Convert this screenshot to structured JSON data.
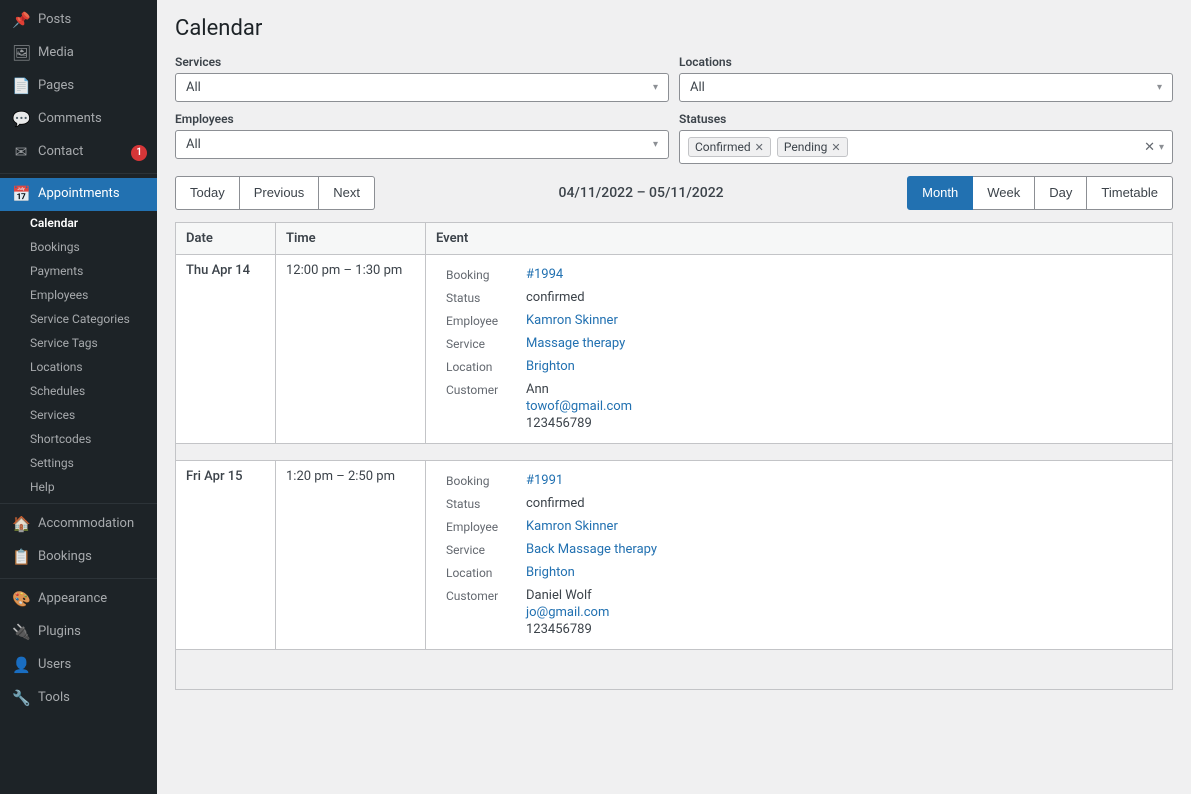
{
  "sidebar": {
    "items": [
      {
        "id": "posts",
        "label": "Posts",
        "icon": "📌",
        "badge": null
      },
      {
        "id": "media",
        "label": "Media",
        "icon": "🖼",
        "badge": null
      },
      {
        "id": "pages",
        "label": "Pages",
        "icon": "📄",
        "badge": null
      },
      {
        "id": "comments",
        "label": "Comments",
        "icon": "💬",
        "badge": null
      },
      {
        "id": "contact",
        "label": "Contact",
        "icon": "✉",
        "badge": "1"
      },
      {
        "id": "appointments",
        "label": "Appointments",
        "icon": "📅",
        "badge": null,
        "active": true
      }
    ],
    "appointments_sub": [
      {
        "id": "calendar",
        "label": "Calendar",
        "active": true
      },
      {
        "id": "bookings",
        "label": "Bookings"
      },
      {
        "id": "payments",
        "label": "Payments"
      },
      {
        "id": "employees",
        "label": "Employees"
      },
      {
        "id": "service-categories",
        "label": "Service Categories"
      },
      {
        "id": "service-tags",
        "label": "Service Tags"
      },
      {
        "id": "locations",
        "label": "Locations"
      },
      {
        "id": "schedules",
        "label": "Schedules"
      },
      {
        "id": "services",
        "label": "Services"
      },
      {
        "id": "shortcodes",
        "label": "Shortcodes"
      },
      {
        "id": "settings",
        "label": "Settings"
      },
      {
        "id": "help",
        "label": "Help"
      }
    ],
    "other_items": [
      {
        "id": "accommodation",
        "label": "Accommodation",
        "icon": "🏠",
        "badge": null
      },
      {
        "id": "bookings2",
        "label": "Bookings",
        "icon": "📋",
        "badge": null
      },
      {
        "id": "appearance",
        "label": "Appearance",
        "icon": "🎨",
        "badge": null
      },
      {
        "id": "plugins",
        "label": "Plugins",
        "icon": "🔌",
        "badge": null
      },
      {
        "id": "users",
        "label": "Users",
        "icon": "👤",
        "badge": null
      },
      {
        "id": "tools",
        "label": "Tools",
        "icon": "🔧",
        "badge": null
      }
    ]
  },
  "page": {
    "title": "Calendar"
  },
  "filters": {
    "services_label": "Services",
    "services_value": "All",
    "locations_label": "Locations",
    "locations_value": "All",
    "employees_label": "Employees",
    "employees_value": "All",
    "statuses_label": "Statuses",
    "active_statuses": [
      "Confirmed",
      "Pending"
    ]
  },
  "calendar_nav": {
    "today_label": "Today",
    "previous_label": "Previous",
    "next_label": "Next",
    "date_range": "04/11/2022 – 05/11/2022",
    "views": [
      {
        "id": "month",
        "label": "Month",
        "active": true
      },
      {
        "id": "week",
        "label": "Week",
        "active": false
      },
      {
        "id": "day",
        "label": "Day",
        "active": false
      },
      {
        "id": "timetable",
        "label": "Timetable",
        "active": false
      }
    ]
  },
  "table": {
    "headers": [
      "Date",
      "Time",
      "Event"
    ],
    "rows": [
      {
        "date": "Thu Apr 14",
        "time": "12:00 pm – 1:30 pm",
        "booking_id": "#1994",
        "booking_href": "#",
        "status": "confirmed",
        "employee": "Kamron Skinner",
        "employee_href": "#",
        "service": "Massage therapy",
        "service_href": "#",
        "location": "Brighton",
        "location_href": "#",
        "customer_name": "Ann",
        "customer_email": "towof@gmail.com",
        "customer_email_href": "#",
        "customer_phone": "123456789"
      },
      {
        "date": "Fri Apr 15",
        "time": "1:20 pm – 2:50 pm",
        "booking_id": "#1991",
        "booking_href": "#",
        "status": "confirmed",
        "employee": "Kamron Skinner",
        "employee_href": "#",
        "service": "Back Massage therapy",
        "service_href": "#",
        "location": "Brighton",
        "location_href": "#",
        "customer_name": "Daniel Wolf",
        "customer_email": "jo@gmail.com",
        "customer_email_href": "#",
        "customer_phone": "123456789"
      }
    ]
  },
  "labels": {
    "booking": "Booking",
    "status": "Status",
    "employee": "Employee",
    "service": "Service",
    "location": "Location",
    "customer": "Customer"
  }
}
